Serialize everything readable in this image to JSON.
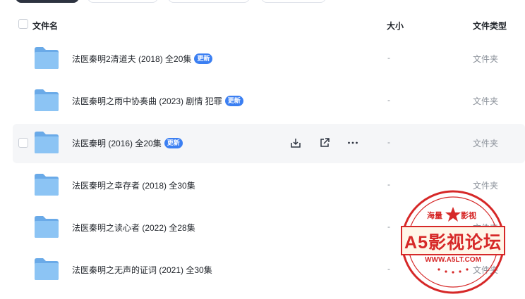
{
  "header": {
    "name_label": "文件名",
    "size_label": "大小",
    "type_label": "文件类型"
  },
  "files": [
    {
      "name": "法医秦明2清道夫 (2018) 全20集",
      "badge": "更新",
      "size": "-",
      "type": "文件夹"
    },
    {
      "name": "法医秦明之雨中协奏曲 (2023)  剧情 犯罪",
      "badge": "更新",
      "size": "-",
      "type": "文件夹"
    },
    {
      "name": "法医秦明 (2016) 全20集",
      "badge": "更新",
      "size": "-",
      "type": "文件夹"
    },
    {
      "name": "法医秦明之幸存者 (2018) 全30集",
      "badge": "",
      "size": "-",
      "type": "文件夹"
    },
    {
      "name": "法医秦明之读心者 (2022) 全28集",
      "badge": "",
      "size": "-",
      "type": "文件夹"
    },
    {
      "name": "法医秦明之无声的证词 (2021) 全30集",
      "badge": "",
      "size": "-",
      "type": "文件夹"
    }
  ],
  "hover_actions": {
    "download_icon": "download-icon",
    "share_icon": "share-icon",
    "more_icon": "more-icon"
  },
  "watermark": {
    "top_left": "海量",
    "top_right": "影视",
    "main": "A5影视论坛",
    "url": "WWW.A5LT.COM"
  },
  "colors": {
    "badge": "#3b7ff2",
    "folder": "#7db8f0",
    "stamp": "#d62828"
  }
}
